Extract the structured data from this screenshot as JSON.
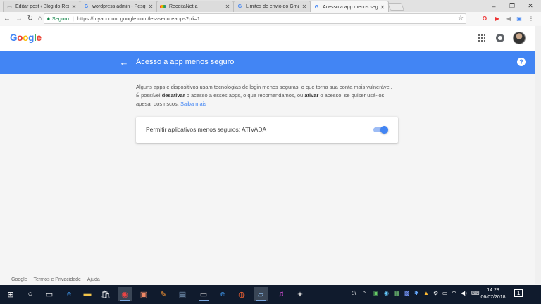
{
  "tabs": [
    {
      "title": "Editar post ‹ Blog do Rec",
      "icon": "document-icon"
    },
    {
      "title": "wordpress admin - Pesqu",
      "icon": "google-g-icon"
    },
    {
      "title": "ReceitaNet a",
      "icon": "rainbow-icon"
    },
    {
      "title": "Limites de envio do Gma",
      "icon": "google-g-icon"
    },
    {
      "title": "Acesso a app menos segu",
      "icon": "google-g-icon"
    }
  ],
  "address": {
    "secure_label": "Seguro",
    "url": "https://myaccount.google.com/lesssecureapps?pli=1"
  },
  "header": {
    "logo_letters": [
      "G",
      "o",
      "o",
      "g",
      "l",
      "e"
    ],
    "logo_colors": [
      "#4285f4",
      "#ea4335",
      "#fbbc05",
      "#4285f4",
      "#34a853",
      "#ea4335"
    ]
  },
  "page": {
    "title": "Acesso a app menos seguro",
    "desc_part1": "Alguns apps e dispositivos usam tecnologias de login menos seguras, o que torna sua conta mais vulnerável. É possível ",
    "desc_bold1": "desativar",
    "desc_part2": " o acesso a esses apps, o que recomendamos, ou ",
    "desc_bold2": "ativar",
    "desc_part3": " o acesso, se quiser usá-los apesar dos riscos. ",
    "learn_more": "Saiba mais",
    "setting_label": "Permitir aplicativos menos seguros: ATIVADA",
    "toggle_on": true
  },
  "footer": {
    "links": [
      "Google",
      "Termos e Privacidade",
      "Ajuda"
    ]
  },
  "taskbar": {
    "time": "14:28",
    "date": "06/07/2018",
    "badge": "1"
  },
  "colors": {
    "accent": "#4285f4",
    "secure": "#0b8043"
  }
}
